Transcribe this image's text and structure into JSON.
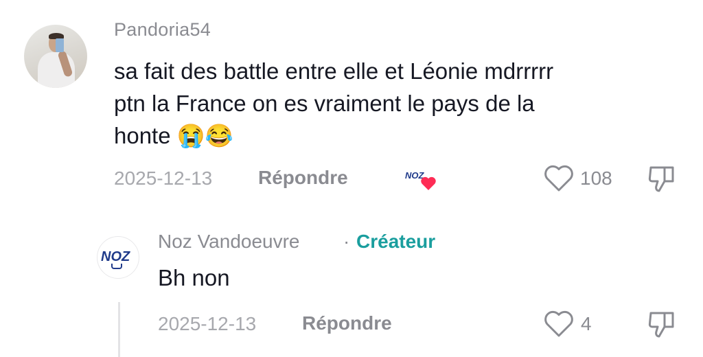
{
  "comment": {
    "username": "Pandoria54",
    "lines": [
      "sa fait des battle entre elle et Léonie mdrrrrr",
      "ptn la France on es vraiment le pays de la",
      "honte 😭😂"
    ],
    "date": "2025-12-13",
    "reply_label": "Répondre",
    "creator_liked_logo": "NOZ",
    "likes": "108",
    "icons": {
      "like": "heart-outline-icon",
      "dislike": "thumbs-down-icon",
      "creator_like": "heart-filled-icon"
    }
  },
  "reply": {
    "username": "Noz Vandoeuvre",
    "separator": "·",
    "badge": "Créateur",
    "avatar_logo": "NOZ",
    "text": "Bh non",
    "date": "2025-12-13",
    "reply_label": "Répondre",
    "likes": "4"
  },
  "colors": {
    "text": "#161823",
    "muted": "#8a8b91",
    "creator_badge": "#1a9e9e",
    "heart": "#fe2c55",
    "noz_blue": "#1f3a8a"
  }
}
